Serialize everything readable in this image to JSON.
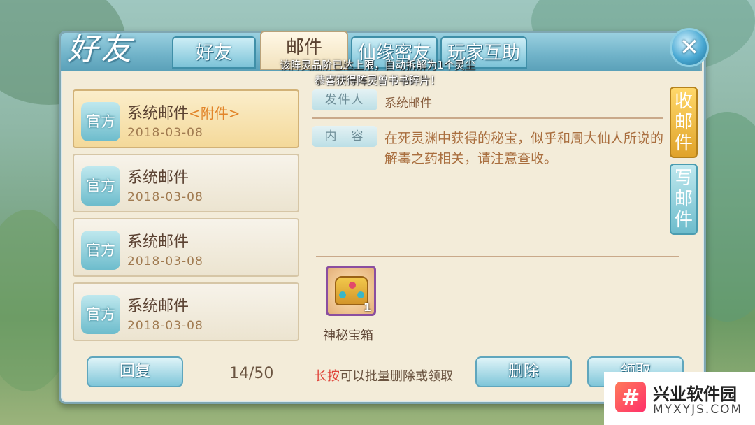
{
  "header": {
    "title": "好友",
    "tabs": [
      {
        "label": "好友",
        "active": false
      },
      {
        "label": "邮件",
        "active": true
      },
      {
        "label": "仙缘密友",
        "active": false
      },
      {
        "label": "玩家互助",
        "active": false
      }
    ],
    "close_icon": "close-icon"
  },
  "notices": {
    "line1": "该阵灵品阶已达上限，自动拆解为1个灵尘",
    "line2": "恭喜获得阵灵曾书书碎片！"
  },
  "mail_list": [
    {
      "badge": "官方",
      "title": "系统邮件",
      "attachment": "<附件>",
      "date": "2018-03-08",
      "selected": true
    },
    {
      "badge": "官方",
      "title": "系统邮件",
      "attachment": "",
      "date": "2018-03-08",
      "selected": false
    },
    {
      "badge": "官方",
      "title": "系统邮件",
      "attachment": "",
      "date": "2018-03-08",
      "selected": false
    },
    {
      "badge": "官方",
      "title": "系统邮件",
      "attachment": "",
      "date": "2018-03-08",
      "selected": false
    }
  ],
  "detail": {
    "sender_label": "发件人",
    "sender_value": "系统邮件",
    "content_label": "内　容",
    "content_text": "在死灵渊中获得的秘宝，似乎和周大仙人所说的解毒之药相关，请注意查收。",
    "item": {
      "name": "神秘宝箱",
      "count": "1",
      "icon": "treasure-chest-icon"
    }
  },
  "side_tabs": {
    "inbox": "收邮件",
    "compose": "写邮件"
  },
  "footer": {
    "reply_label": "回复",
    "counter": "14/50",
    "hint_highlight": "长按",
    "hint_rest": "可以批量删除或领取",
    "delete_label": "删除",
    "claim_label": "领取"
  },
  "watermark": {
    "logo_glyph": "#",
    "name": "兴业软件园",
    "url": "MYXYJS.COM"
  },
  "colors": {
    "accent_blue": "#7fc6d9",
    "attachment_orange": "#e2852a",
    "hint_red": "#e0443a",
    "panel_bg": "#f3ecd9"
  }
}
